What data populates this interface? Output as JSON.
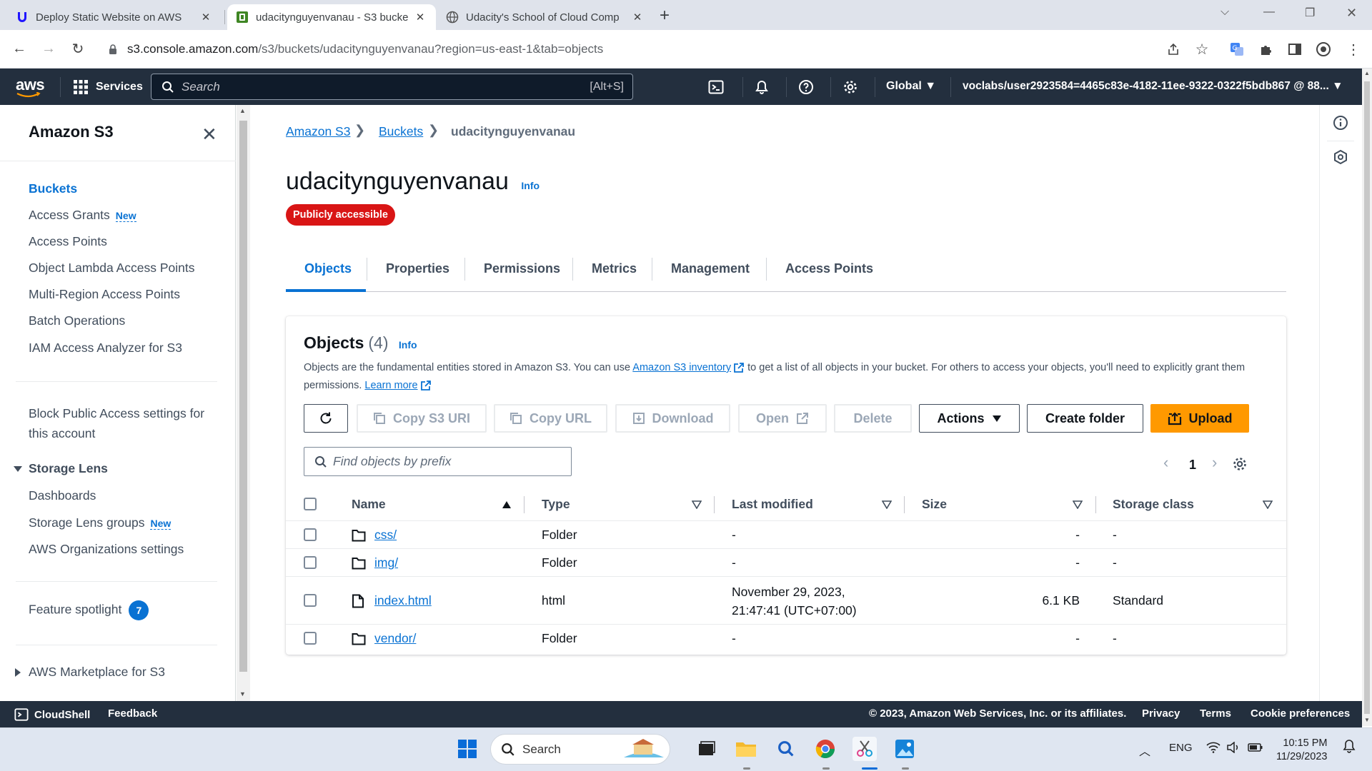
{
  "browser": {
    "tabs": [
      {
        "title": "Deploy Static Website on AWS",
        "active": false
      },
      {
        "title": "udacitynguyenvanau - S3 bucke",
        "active": true
      },
      {
        "title": "Udacity's School of Cloud Comp",
        "active": false
      }
    ],
    "url_host": "s3.console.amazon.com",
    "url_path": "/s3/buckets/udacitynguyenvanau?region=us-east-1&tab=objects"
  },
  "awsnav": {
    "logo": "aws",
    "services": "Services",
    "search_placeholder": "Search",
    "search_shortcut": "[Alt+S]",
    "region": "Global",
    "account": "voclabs/user2923584=4465c83e-4182-11ee-9322-0322f5bdb867 @ 88..."
  },
  "sidenav": {
    "title": "Amazon S3",
    "items": [
      {
        "label": "Buckets",
        "active": true
      },
      {
        "label": "Access Grants",
        "badge": "New"
      },
      {
        "label": "Access Points"
      },
      {
        "label": "Object Lambda Access Points"
      },
      {
        "label": "Multi-Region Access Points"
      },
      {
        "label": "Batch Operations"
      },
      {
        "label": "IAM Access Analyzer for S3"
      }
    ],
    "block_public_line1": "Block Public Access settings for",
    "block_public_line2": "this account",
    "storage_lens": {
      "title": "Storage Lens",
      "items": [
        {
          "label": "Dashboards"
        },
        {
          "label": "Storage Lens groups",
          "badge": "New"
        },
        {
          "label": "AWS Organizations settings"
        }
      ]
    },
    "feature_spotlight": "Feature spotlight",
    "feature_count": "7",
    "marketplace": "AWS Marketplace for S3"
  },
  "breadcrumb": [
    "Amazon S3",
    "Buckets",
    "udacitynguyenvanau"
  ],
  "bucket": {
    "name": "udacitynguyenvanau",
    "info": "Info",
    "badge": "Publicly accessible"
  },
  "tabs": [
    "Objects",
    "Properties",
    "Permissions",
    "Metrics",
    "Management",
    "Access Points"
  ],
  "objects": {
    "title": "Objects",
    "count": "(4)",
    "info": "Info",
    "desc_pre": "Objects are the fundamental entities stored in Amazon S3. You can use ",
    "desc_link": "Amazon S3 inventory",
    "desc_mid": " to get a list of all objects in your bucket. For others to access your objects, you'll need to explicitly grant them permissions. ",
    "desc_learn": "Learn more",
    "buttons": {
      "copy_uri": "Copy S3 URI",
      "copy_url": "Copy URL",
      "download": "Download",
      "open": "Open",
      "delete": "Delete",
      "actions": "Actions",
      "create_folder": "Create folder",
      "upload": "Upload"
    },
    "filter_placeholder": "Find objects by prefix",
    "page": "1",
    "columns": [
      "Name",
      "Type",
      "Last modified",
      "Size",
      "Storage class"
    ],
    "rows": [
      {
        "name": "css/",
        "icon": "folder-icon",
        "type": "Folder",
        "modified1": "-",
        "modified2": "",
        "size": "-",
        "class": "-"
      },
      {
        "name": "img/",
        "icon": "folder-icon",
        "type": "Folder",
        "modified1": "-",
        "modified2": "",
        "size": "-",
        "class": "-"
      },
      {
        "name": "index.html",
        "icon": "file-icon",
        "type": "html",
        "modified1": "November 29, 2023,",
        "modified2": "21:47:41 (UTC+07:00)",
        "size": "6.1 KB",
        "class": "Standard"
      },
      {
        "name": "vendor/",
        "icon": "folder-icon",
        "type": "Folder",
        "modified1": "-",
        "modified2": "",
        "size": "-",
        "class": "-"
      }
    ]
  },
  "footer": {
    "cloudshell": "CloudShell",
    "feedback": "Feedback",
    "copyright": "© 2023, Amazon Web Services, Inc. or its affiliates.",
    "privacy": "Privacy",
    "terms": "Terms",
    "cookie": "Cookie preferences"
  },
  "taskbar": {
    "search": "Search",
    "lang": "ENG",
    "time": "10:15 PM",
    "date": "11/29/2023"
  },
  "colors": {
    "aws_nav": "#232f3e",
    "link": "#0972d3",
    "upload": "#ff9900",
    "danger": "#d91515"
  }
}
